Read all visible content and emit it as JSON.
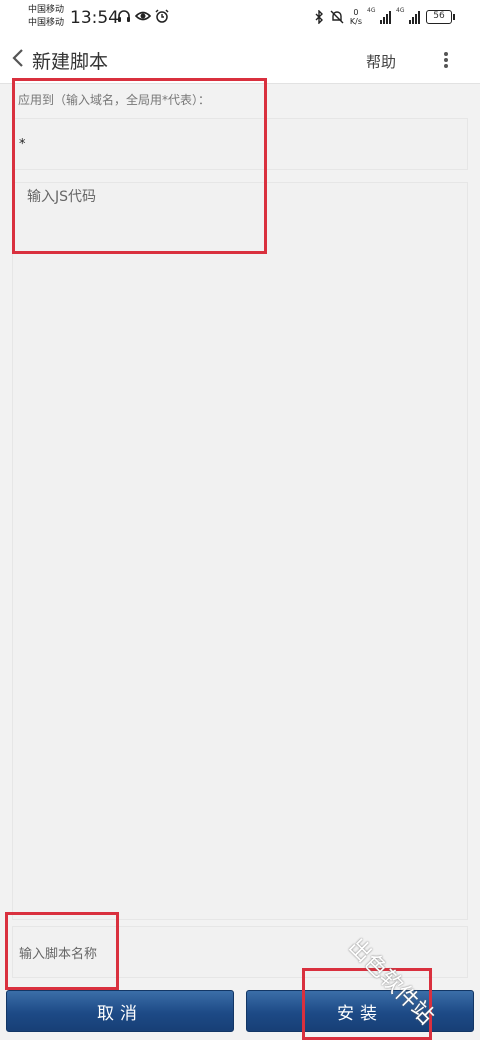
{
  "status_bar": {
    "carrier_1": "中国移动",
    "carrier_2": "中国移动",
    "time": "13:54",
    "net_speed_value": "0",
    "net_speed_unit": "K/s",
    "signal_1_type": "4G",
    "signal_2_type": "4G",
    "battery": "56",
    "icons": [
      "headphones-icon",
      "eye-icon",
      "alarm-icon",
      "bluetooth-icon",
      "mute-icon"
    ]
  },
  "app_bar": {
    "back_glyph": "‹",
    "title": "新建脚本",
    "help_label": "帮助"
  },
  "form": {
    "apply_label": "应用到（输入域名，全局用*代表）：",
    "domain_value": "*",
    "code_placeholder": "输入JS代码",
    "name_placeholder": "输入脚本名称"
  },
  "buttons": {
    "cancel": "取消",
    "install": "安装"
  },
  "watermark": "出色软件站",
  "colors": {
    "button_blue": "#1d4a86",
    "annotation_red": "#d9303e",
    "field_bg": "#f1f1f1"
  }
}
